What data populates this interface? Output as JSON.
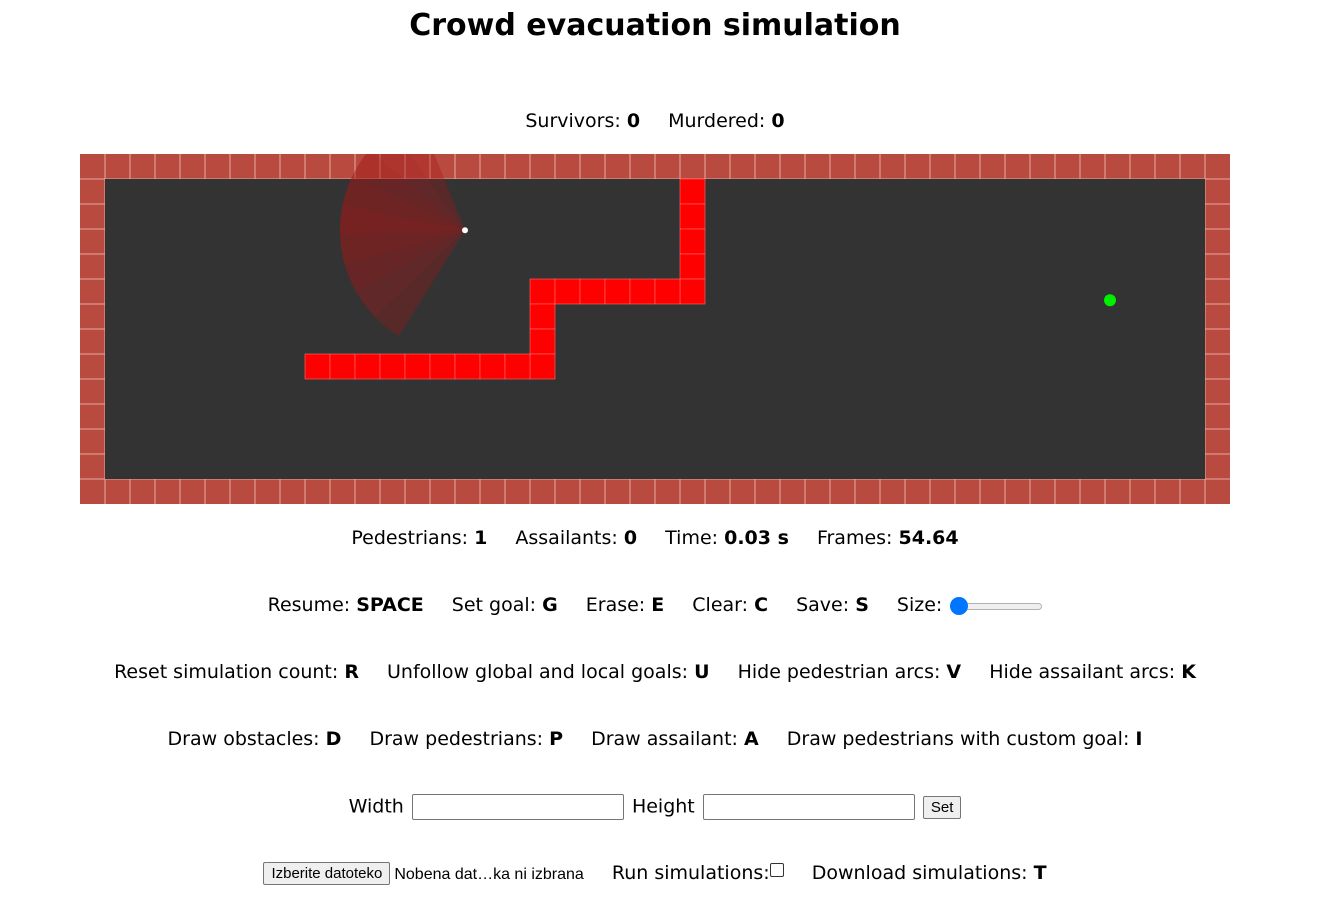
{
  "title": "Crowd evacuation simulation",
  "stats": {
    "survivors_label": "Survivors:",
    "survivors": "0",
    "murdered_label": "Murdered:",
    "murdered": "0"
  },
  "info": {
    "pedestrians_label": "Pedestrians:",
    "pedestrians": "1",
    "assailants_label": "Assailants:",
    "assailants": "0",
    "time_label": "Time:",
    "time": "0.03 s",
    "frames_label": "Frames:",
    "frames": "54.64"
  },
  "controls1": {
    "resume_label": "Resume:",
    "resume_key": "SPACE",
    "goal_label": "Set goal:",
    "goal_key": "G",
    "erase_label": "Erase:",
    "erase_key": "E",
    "clear_label": "Clear:",
    "clear_key": "C",
    "save_label": "Save:",
    "save_key": "S",
    "size_label": "Size:"
  },
  "size_slider": {
    "value": 0
  },
  "controls2": {
    "reset_label": "Reset simulation count:",
    "reset_key": "R",
    "unfollow_label": "Unfollow global and local goals:",
    "unfollow_key": "U",
    "hide_ped_label": "Hide pedestrian arcs:",
    "hide_ped_key": "V",
    "hide_ass_label": "Hide assailant arcs:",
    "hide_ass_key": "K"
  },
  "controls3": {
    "draw_obs_label": "Draw obstacles:",
    "draw_obs_key": "D",
    "draw_ped_label": "Draw pedestrians:",
    "draw_ped_key": "P",
    "draw_ass_label": "Draw assailant:",
    "draw_ass_key": "A",
    "draw_custom_label": "Draw pedestrians with custom goal:",
    "draw_custom_key": "I"
  },
  "dims": {
    "width_label": "Width",
    "height_label": "Height",
    "width_value": "",
    "height_value": "",
    "set_label": "Set"
  },
  "files": {
    "choose_label": "Izberite datoteko",
    "file_status": "Nobena dat…ka ni izbrana",
    "run_label": "Run simulations:",
    "run_checked": false,
    "download_label": "Download simulations:",
    "download_key": "T"
  },
  "colors": {
    "wall": "#b84a3f",
    "wall_line": "#e8a8a0",
    "floor": "#333333",
    "obstacle": "#ff0000",
    "goal": "#00ee00",
    "pedestrian": "#ffffff",
    "arc": "#a01818"
  },
  "grid": {
    "cols": 46,
    "rows": 14,
    "obstacle_cells": [
      [
        24,
        1
      ],
      [
        24,
        2
      ],
      [
        24,
        3
      ],
      [
        24,
        4
      ],
      [
        24,
        5
      ],
      [
        18,
        5
      ],
      [
        19,
        5
      ],
      [
        20,
        5
      ],
      [
        21,
        5
      ],
      [
        22,
        5
      ],
      [
        23,
        5
      ],
      [
        18,
        6
      ],
      [
        18,
        7
      ],
      [
        18,
        8
      ],
      [
        9,
        8
      ],
      [
        10,
        8
      ],
      [
        11,
        8
      ],
      [
        12,
        8
      ],
      [
        13,
        8
      ],
      [
        14,
        8
      ],
      [
        15,
        8
      ],
      [
        16,
        8
      ],
      [
        17,
        8
      ]
    ],
    "pedestrian": [
      15.4,
      3.05
    ],
    "goal": [
      41.2,
      5.85
    ],
    "arc_radius_cells": 5,
    "arc_angles": [
      122,
      136,
      150,
      164,
      178,
      192,
      206,
      220,
      234,
      248
    ]
  }
}
